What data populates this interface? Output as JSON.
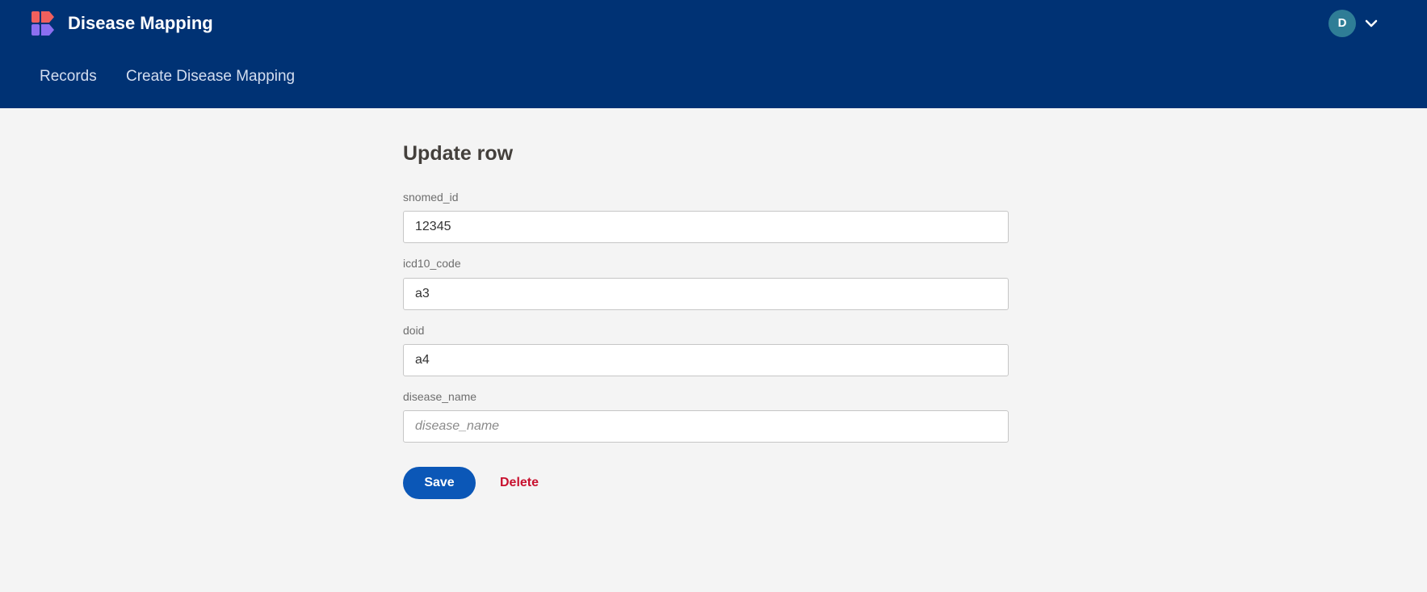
{
  "header": {
    "app_title": "Disease Mapping",
    "user_initial": "D",
    "nav": [
      {
        "label": "Records"
      },
      {
        "label": "Create Disease Mapping"
      }
    ]
  },
  "form": {
    "title": "Update row",
    "fields": [
      {
        "label": "snomed_id",
        "value": "12345",
        "placeholder": ""
      },
      {
        "label": "icd10_code",
        "value": "a3",
        "placeholder": ""
      },
      {
        "label": "doid",
        "value": "a4",
        "placeholder": ""
      },
      {
        "label": "disease_name",
        "value": "",
        "placeholder": "disease_name"
      }
    ],
    "save_label": "Save",
    "delete_label": "Delete"
  },
  "colors": {
    "header_bg": "#003274",
    "save_button": "#0b57b7",
    "delete_text": "#c8102e",
    "avatar_bg": "#2f7d96"
  },
  "icons": [
    "app-logo-icon",
    "chevron-down-icon"
  ]
}
